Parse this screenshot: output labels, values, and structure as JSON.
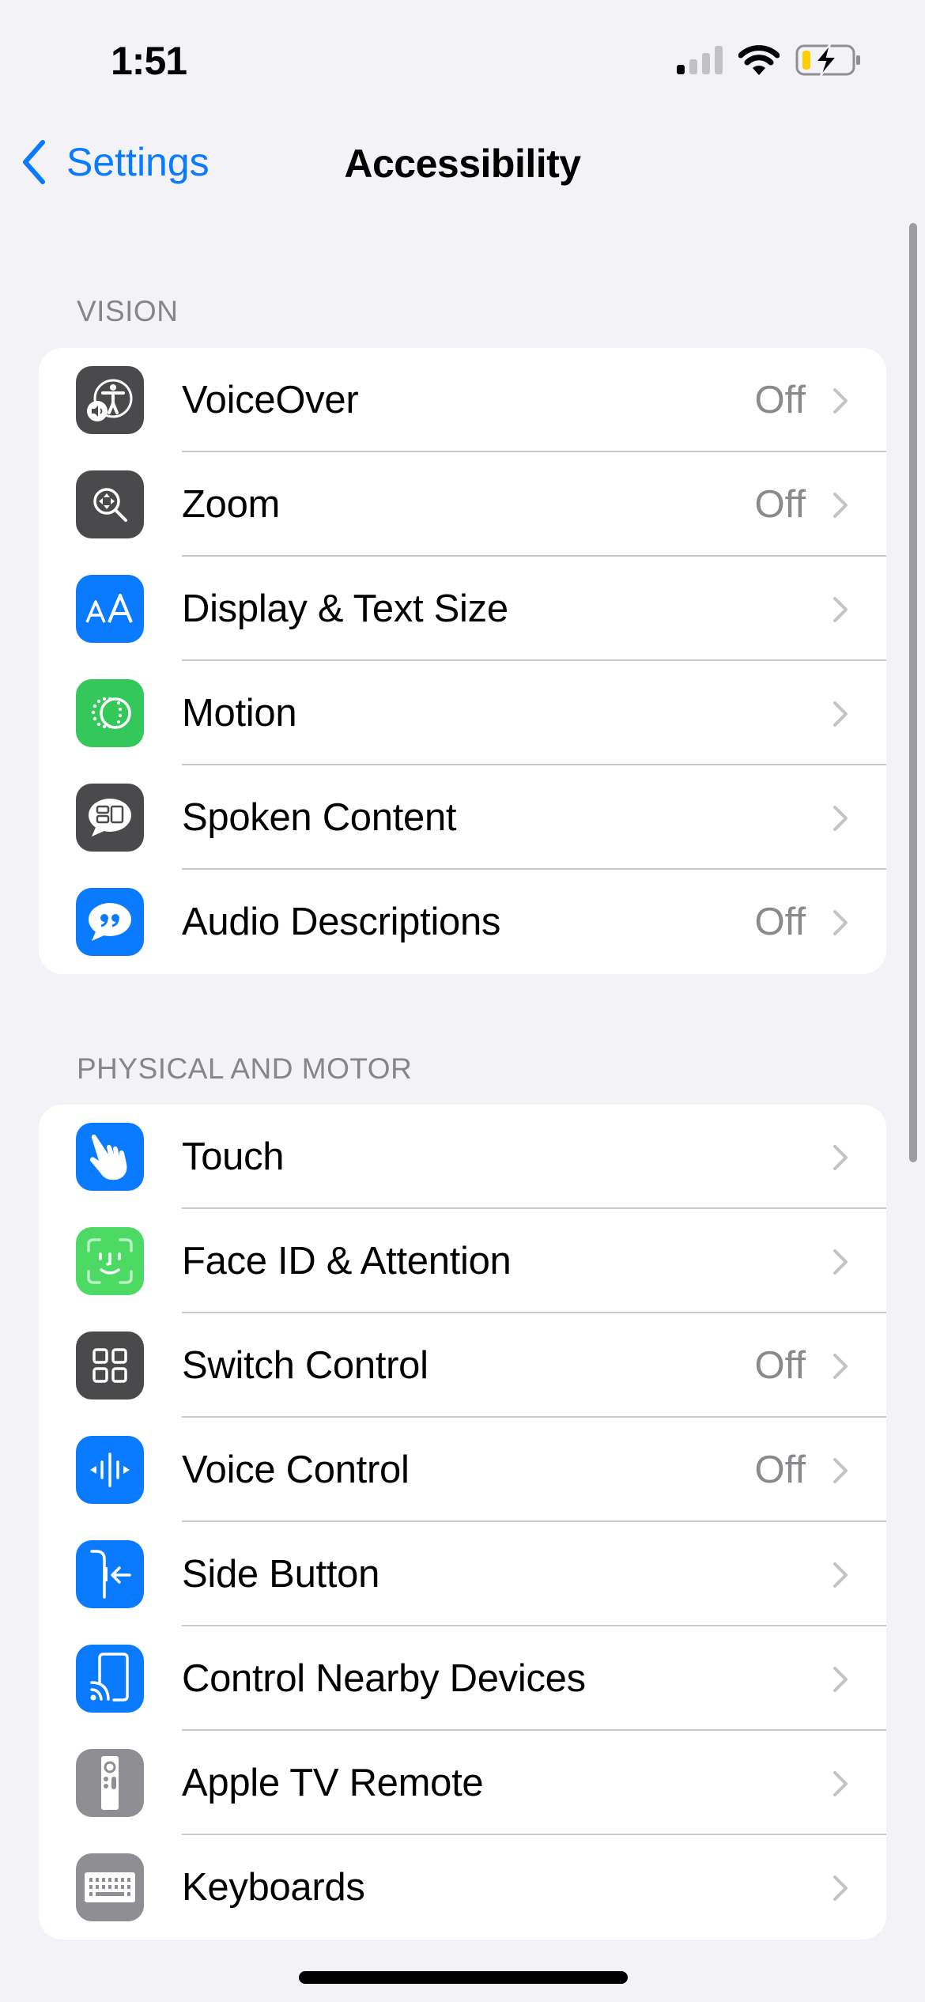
{
  "status_bar": {
    "time": "1:51",
    "signal_bars_active": 1,
    "signal_bars_total": 4,
    "wifi": "wifi-icon",
    "battery": {
      "charging": true,
      "level_color": "#ffcc00"
    }
  },
  "nav": {
    "back_label": "Settings",
    "title": "Accessibility"
  },
  "colors": {
    "accent": "#0a7aff",
    "background": "#f2f2f7",
    "secondary_text": "#8a8a8e"
  },
  "sections": [
    {
      "header": "VISION",
      "items": [
        {
          "label": "VoiceOver",
          "value": "Off",
          "icon": "voiceover-icon",
          "icon_color": "#4a4a4c"
        },
        {
          "label": "Zoom",
          "value": "Off",
          "icon": "zoom-icon",
          "icon_color": "#4a4a4c"
        },
        {
          "label": "Display & Text Size",
          "value": "",
          "icon": "display-text-size-icon",
          "icon_color": "#0a7aff"
        },
        {
          "label": "Motion",
          "value": "",
          "icon": "motion-icon",
          "icon_color": "#34c759"
        },
        {
          "label": "Spoken Content",
          "value": "",
          "icon": "spoken-content-icon",
          "icon_color": "#4a4a4c"
        },
        {
          "label": "Audio Descriptions",
          "value": "Off",
          "icon": "audio-descriptions-icon",
          "icon_color": "#0a7aff"
        }
      ]
    },
    {
      "header": "PHYSICAL AND MOTOR",
      "items": [
        {
          "label": "Touch",
          "value": "",
          "icon": "touch-icon",
          "icon_color": "#0a7aff"
        },
        {
          "label": "Face ID & Attention",
          "value": "",
          "icon": "face-id-icon",
          "icon_color": "#4cd964"
        },
        {
          "label": "Switch Control",
          "value": "Off",
          "icon": "switch-control-icon",
          "icon_color": "#4a4a4c"
        },
        {
          "label": "Voice Control",
          "value": "Off",
          "icon": "voice-control-icon",
          "icon_color": "#0a7aff"
        },
        {
          "label": "Side Button",
          "value": "",
          "icon": "side-button-icon",
          "icon_color": "#0a7aff"
        },
        {
          "label": "Control Nearby Devices",
          "value": "",
          "icon": "control-nearby-devices-icon",
          "icon_color": "#0a7aff"
        },
        {
          "label": "Apple TV Remote",
          "value": "",
          "icon": "apple-tv-remote-icon",
          "icon_color": "#8e8e93"
        },
        {
          "label": "Keyboards",
          "value": "",
          "icon": "keyboard-icon",
          "icon_color": "#8e8e93"
        }
      ]
    }
  ]
}
